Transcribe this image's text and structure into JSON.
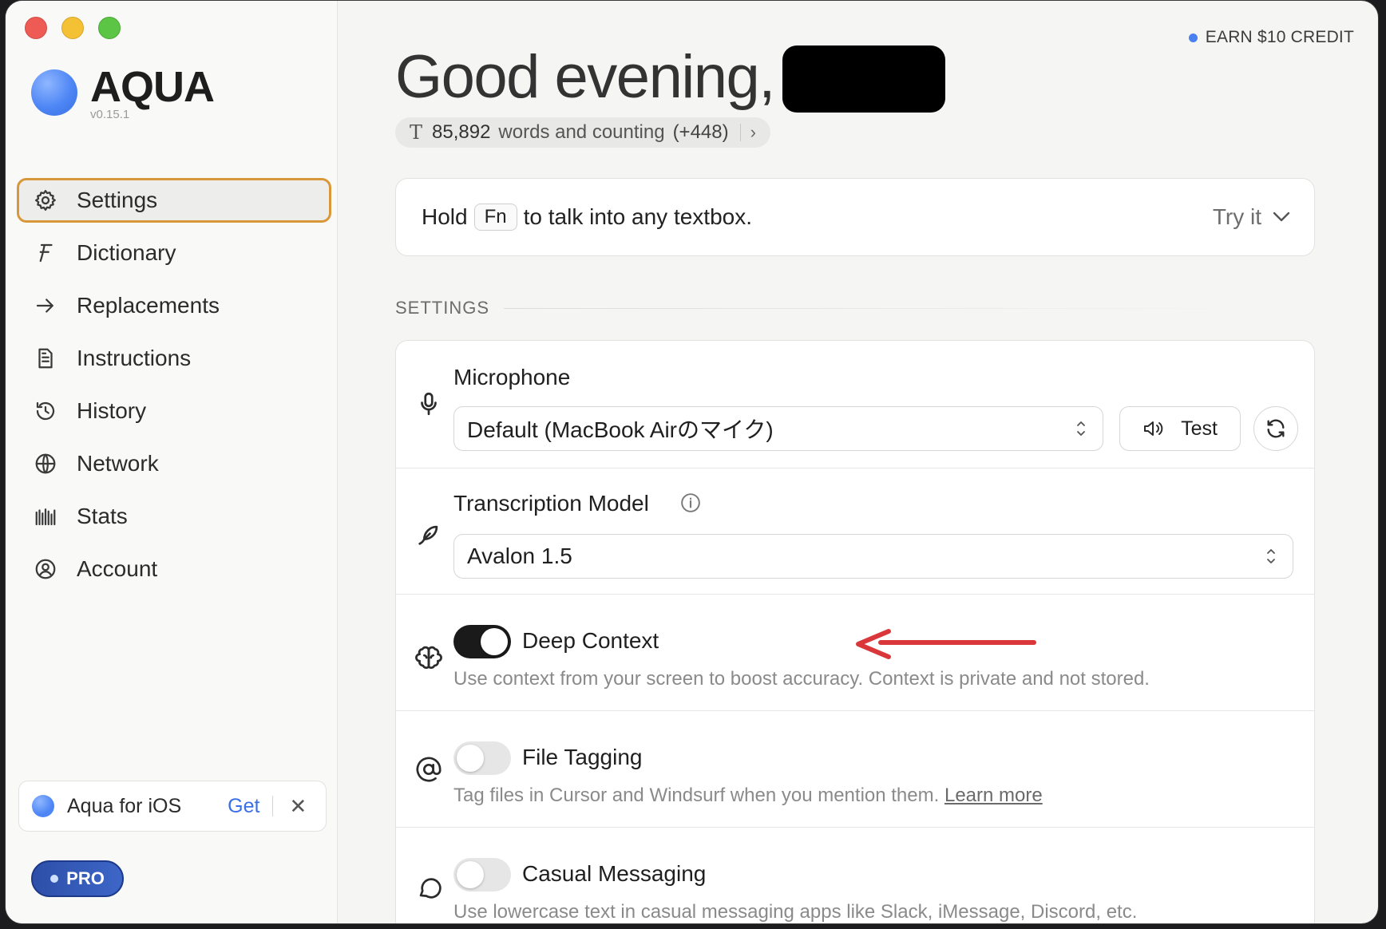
{
  "app": {
    "name": "AQUA",
    "version": "v0.15.1"
  },
  "sidebar": {
    "items": [
      {
        "label": "Settings",
        "icon": "gear-icon",
        "active": true
      },
      {
        "label": "Dictionary",
        "icon": "dictionary-icon",
        "active": false
      },
      {
        "label": "Replacements",
        "icon": "arrow-right-icon",
        "active": false
      },
      {
        "label": "Instructions",
        "icon": "document-icon",
        "active": false
      },
      {
        "label": "History",
        "icon": "history-icon",
        "active": false
      },
      {
        "label": "Network",
        "icon": "globe-icon",
        "active": false
      },
      {
        "label": "Stats",
        "icon": "stats-icon",
        "active": false
      },
      {
        "label": "Account",
        "icon": "account-icon",
        "active": false
      }
    ],
    "ios_promo": {
      "label": "Aqua for iOS",
      "action": "Get",
      "close": "✕"
    },
    "plan_badge": "PRO"
  },
  "header": {
    "earn_credit": "EARN $10 CREDIT",
    "greeting": "Good evening,",
    "words": {
      "count": "85,892",
      "label": "words and counting",
      "delta": "(+448)",
      "chevron": "›"
    }
  },
  "hold_card": {
    "prefix": "Hold",
    "key": "Fn",
    "suffix": "to talk into any textbox.",
    "try_label": "Try it"
  },
  "settings": {
    "section_label": "SETTINGS",
    "microphone": {
      "title": "Microphone",
      "selected": "Default (MacBook Airのマイク)",
      "test_label": "Test"
    },
    "transcription": {
      "title": "Transcription Model",
      "selected": "Avalon 1.5"
    },
    "deep_context": {
      "title": "Deep Context",
      "enabled": true,
      "description": "Use context from your screen to boost accuracy. Context is private and not stored."
    },
    "file_tagging": {
      "title": "File Tagging",
      "enabled": false,
      "description": "Tag files in Cursor and Windsurf when you mention them.",
      "link": "Learn more"
    },
    "casual_messaging": {
      "title": "Casual Messaging",
      "enabled": false,
      "description": "Use lowercase text in casual messaging apps like Slack, iMessage, Discord, etc."
    }
  },
  "colors": {
    "accent": "#3b6fe6",
    "active_border": "#d8983a",
    "annotation": "#d9373a"
  }
}
